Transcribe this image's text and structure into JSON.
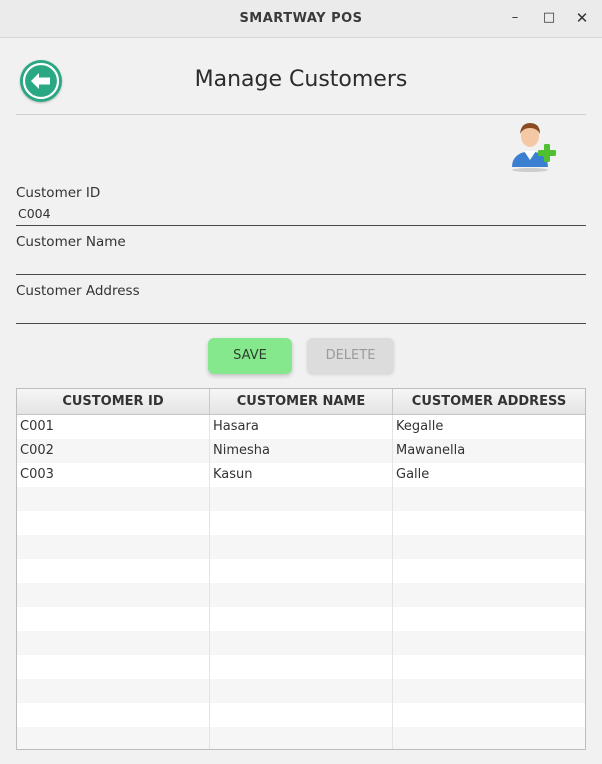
{
  "window": {
    "title": "SMARTWAY POS",
    "min": "–",
    "max": "□",
    "close": "✕"
  },
  "header": {
    "title": "Manage Customers"
  },
  "form": {
    "customer_id": {
      "label": "Customer ID",
      "value": "C004"
    },
    "customer_name": {
      "label": "Customer Name",
      "value": ""
    },
    "customer_address": {
      "label": "Customer Address",
      "value": ""
    }
  },
  "buttons": {
    "save": "SAVE",
    "delete": "DELETE"
  },
  "table": {
    "headers": [
      "CUSTOMER ID",
      "CUSTOMER NAME",
      "CUSTOMER ADDRESS"
    ],
    "rows": [
      [
        "C001",
        "Hasara",
        "Kegalle"
      ],
      [
        "C002",
        "Nimesha",
        "Mawanella"
      ],
      [
        "C003",
        "Kasun",
        "Galle"
      ]
    ],
    "empty_rows": 11
  },
  "colors": {
    "accent_back": "#2aa884",
    "save_bg": "#86e88c",
    "delete_bg": "#dcdcdc"
  },
  "icons": {
    "back": "arrow-left-circle",
    "add_user": "add-user"
  }
}
